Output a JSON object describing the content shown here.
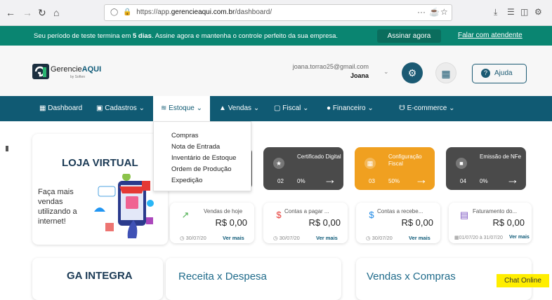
{
  "browser": {
    "url_prefix": "https://app.",
    "url_domain": "gerencieaqui.com.br",
    "url_path": "/dashboard/",
    "more": "···"
  },
  "trial": {
    "message_pre": "Seu período de teste termina em ",
    "message_days": "5 dias",
    "message_post": ". Assine agora e mantenha o controle perfeito da sua empresa.",
    "subscribe": "Assinar agora",
    "talk": "Falar com atendente"
  },
  "header": {
    "logo_main": "Gerencie",
    "logo_bold": "AQUI",
    "logo_sub": "by Soften",
    "email": "joana.torrao25@gmail.com",
    "user": "Joana",
    "help": "Ajuda"
  },
  "menu": {
    "dashboard": "Dashboard",
    "cadastros": "Cadastros",
    "estoque": "Estoque",
    "vendas": "Vendas",
    "fiscal": "Fiscal",
    "financeiro": "Financeiro",
    "ecommerce": "E-commerce"
  },
  "dropdown": {
    "items": [
      "Compras",
      "Nota de Entrada",
      "Inventário de Estoque",
      "Ordem de Produção",
      "Expedição"
    ]
  },
  "loja": {
    "title": "LOJA VIRTUAL",
    "subtitle": "Faça mais vendas utilizando a internet!"
  },
  "status_cards": [
    {
      "title": "Certificado Digital",
      "count": "02",
      "percent": "0%",
      "color": "#4a4a4a"
    },
    {
      "title": "Configuração Fiscal",
      "count": "03",
      "percent": "50%",
      "color": "#f0a020"
    },
    {
      "title": "Emissão de NFe",
      "count": "04",
      "percent": "0%",
      "color": "#4a4a4a"
    }
  ],
  "kpis": [
    {
      "label": "Vendas de hoje",
      "value": "R$ 0,00",
      "date": "30/07/20",
      "more": "Ver mais"
    },
    {
      "label": "Contas a pagar ...",
      "value": "R$ 0,00",
      "date": "30/07/20",
      "more": "Ver mais"
    },
    {
      "label": "Contas a recebe...",
      "value": "R$ 0,00",
      "date": "30/07/20",
      "more": "Ver mais"
    },
    {
      "label": "Faturamento do...",
      "value": "R$ 0,00",
      "date": "01/07/20 à 31/07/20",
      "more": "Ver mais"
    }
  ],
  "bottom": {
    "ga": "GA INTEGRA",
    "receita": "Receita x Despesa",
    "vendas_compras": "Vendas x Compras"
  },
  "chat": "Chat Online",
  "colors": {
    "teal": "#0a8571",
    "navy": "#105a73",
    "orange": "#f0a020",
    "dark": "#4a4a4a",
    "chat": "#ffee00"
  }
}
